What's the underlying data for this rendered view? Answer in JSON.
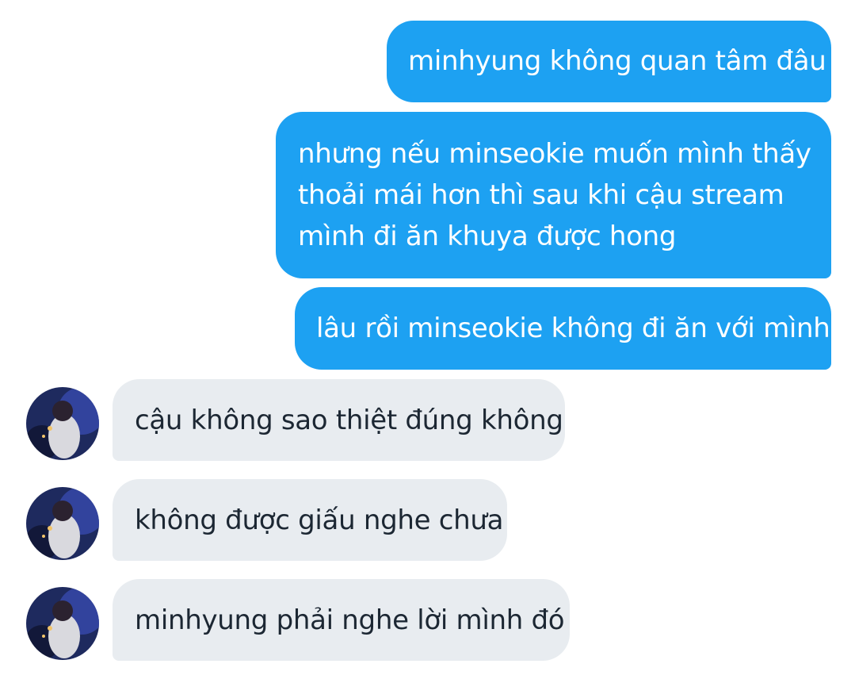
{
  "conversation": {
    "messages": [
      {
        "direction": "sent",
        "text": "minhyung không quan tâm đâu"
      },
      {
        "direction": "sent",
        "lines": [
          "nhưng nếu minseokie muốn mình thấy",
          "thoải mái hơn thì sau khi cậu stream",
          "mình đi ăn khuya được hong"
        ]
      },
      {
        "direction": "sent",
        "text": "lâu rồi minseokie không đi ăn với mình"
      },
      {
        "direction": "received",
        "text": "cậu không sao thiệt đúng không"
      },
      {
        "direction": "received",
        "text": "không được giấu nghe chưa"
      },
      {
        "direction": "received",
        "text": "minhyung phải nghe lời mình đó"
      }
    ]
  },
  "colors": {
    "sent_bubble": "#1da1f2",
    "received_bubble": "#e8ecf0",
    "sent_text": "#ffffff",
    "received_text": "#1c2733"
  },
  "icons": {
    "contact_avatar": "contact-avatar-photo"
  }
}
